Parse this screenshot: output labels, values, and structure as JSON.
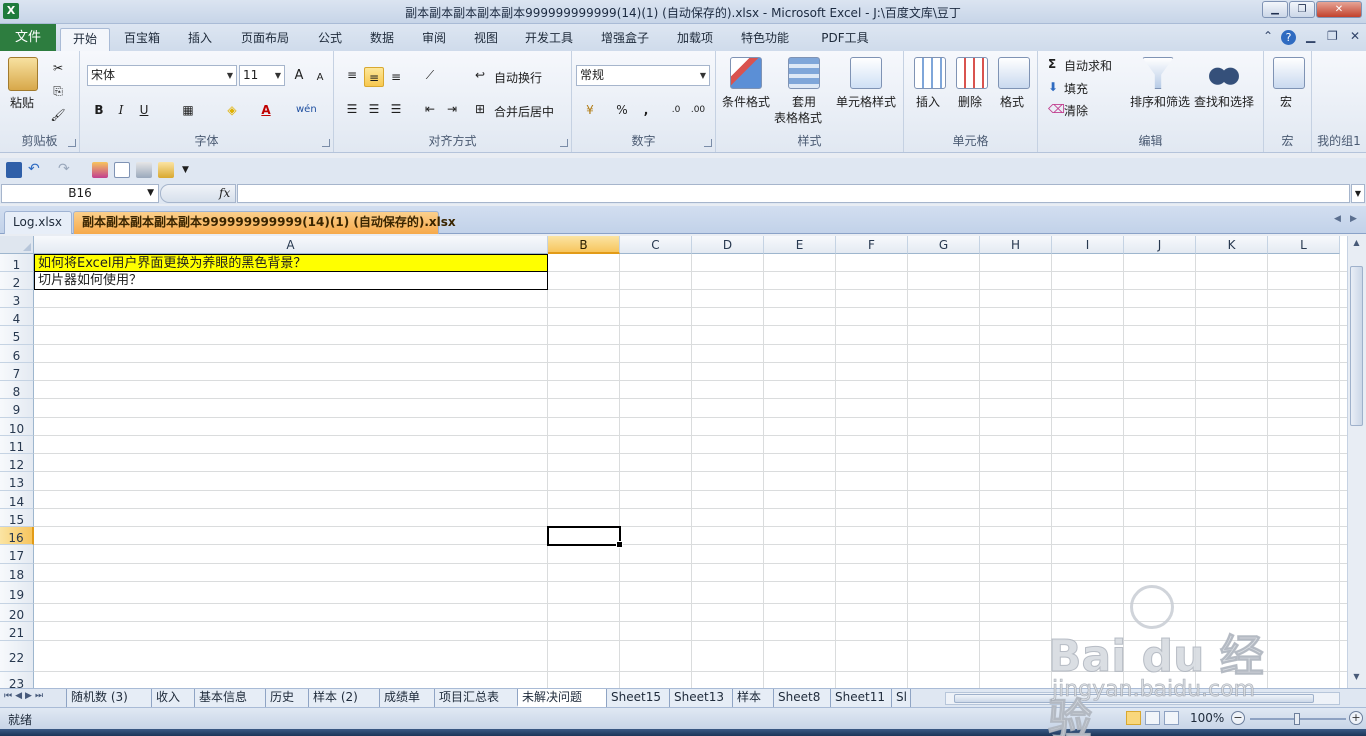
{
  "window": {
    "title": "副本副本副本副本副本999999999999(14)(1) (自动保存的).xlsx - Microsoft Excel - J:\\百度文库\\豆丁",
    "app_icon": "X"
  },
  "menu_tabs": [
    "文件",
    "开始",
    "百宝箱",
    "插入",
    "页面布局",
    "公式",
    "数据",
    "审阅",
    "视图",
    "开发工具",
    "增强盒子",
    "加载项",
    "特色功能",
    "PDF工具"
  ],
  "active_tab": "开始",
  "ribbon": {
    "clipboard": {
      "label": "剪贴板",
      "paste": "粘贴"
    },
    "font": {
      "label": "字体",
      "font_name": "宋体",
      "font_size": "11",
      "bold": "B",
      "italic": "I",
      "underline": "U",
      "grow": "A",
      "shrink": "A",
      "phonetic": "wén"
    },
    "alignment": {
      "label": "对齐方式",
      "wrap_text": "自动换行",
      "merge_center": "合并后居中"
    },
    "number": {
      "label": "数字",
      "format": "常规",
      "percent": "%",
      "comma": ","
    },
    "styles": {
      "label": "样式",
      "conditional": "条件格式",
      "table_format_line1": "套用",
      "table_format_line2": "表格格式",
      "cell_styles": "单元格样式"
    },
    "cells": {
      "label": "单元格",
      "insert": "插入",
      "delete": "删除",
      "format": "格式"
    },
    "editing": {
      "label": "编辑",
      "autosum": "自动求和",
      "fill": "填充",
      "clear": "清除",
      "sort_filter": "排序和筛选",
      "find_select": "查找和选择",
      "sigma": "Σ"
    },
    "macro": {
      "label": "宏",
      "macro": "宏"
    },
    "my_group": {
      "label": "我的组1"
    }
  },
  "formula_bar": {
    "name_box": "B16",
    "fx": "fx",
    "content": ""
  },
  "workbooks": [
    "Log.xlsx",
    "副本副本副本副本副本999999999999(14)(1) (自动保存的).xlsx"
  ],
  "grid": {
    "columns": [
      "A",
      "B",
      "C",
      "D",
      "E",
      "F",
      "G",
      "H",
      "I",
      "J",
      "K",
      "L"
    ],
    "selected_column": "B",
    "rows": [
      "1",
      "2",
      "3",
      "4",
      "5",
      "6",
      "7",
      "8",
      "9",
      "10",
      "11",
      "12",
      "13",
      "14",
      "15",
      "16",
      "17",
      "18",
      "19",
      "20",
      "21",
      "22",
      "23"
    ],
    "selected_row": "16",
    "cells": {
      "A1": "如何将Excel用户界面更换为养眼的黑色背景？",
      "A2": "切片器如何使用？"
    },
    "highlight_color": "#ffff00"
  },
  "sheet_tabs": [
    "随机数 (3)",
    "收入",
    "基本信息",
    "历史",
    "样本 (2)",
    "成绩单",
    "项目汇总表",
    "未解决问题",
    "Sheet15",
    "Sheet13",
    "样本",
    "Sheet8",
    "Sheet11",
    "Sl"
  ],
  "active_sheet": "未解决问题",
  "status": {
    "ready": "就绪",
    "zoom": "100%"
  },
  "watermark": {
    "brand": "Bai du 经验",
    "url": "jingyan.baidu.com"
  }
}
